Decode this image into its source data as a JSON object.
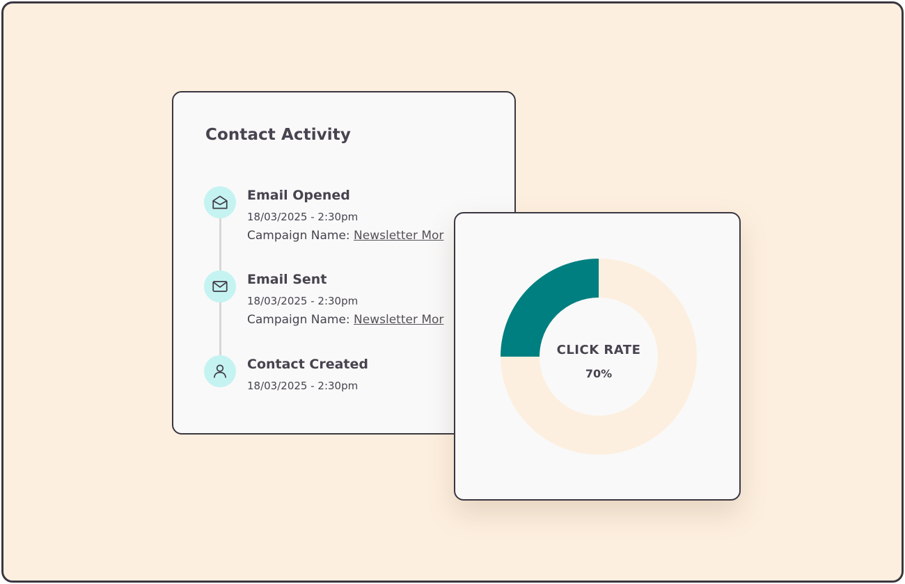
{
  "activity": {
    "title": "Contact Activity",
    "items": [
      {
        "icon": "envelope-open-icon",
        "title": "Email Opened",
        "time": "18/03/2025 - 2:30pm",
        "campaign_label": "Campaign Name:",
        "campaign_name": "Newsletter Mor"
      },
      {
        "icon": "envelope-icon",
        "title": "Email Sent",
        "time": "18/03/2025 - 2:30pm",
        "campaign_label": "Campaign Name:",
        "campaign_name": "Newsletter Mor"
      },
      {
        "icon": "user-icon",
        "title": "Contact Created",
        "time": "18/03/2025 - 2:30pm"
      }
    ]
  },
  "chart_data": {
    "type": "pie",
    "label": "CLICK RATE",
    "value_text": "70%",
    "slices": [
      {
        "value": 75,
        "color": "#fdefdf"
      },
      {
        "value": 25,
        "color": "#007f80"
      }
    ]
  },
  "colors": {
    "background": "#fdefdf",
    "card": "#f9f9f9",
    "accent": "#007f80",
    "icon_bg": "#c5f3f1",
    "text": "#47434f"
  }
}
